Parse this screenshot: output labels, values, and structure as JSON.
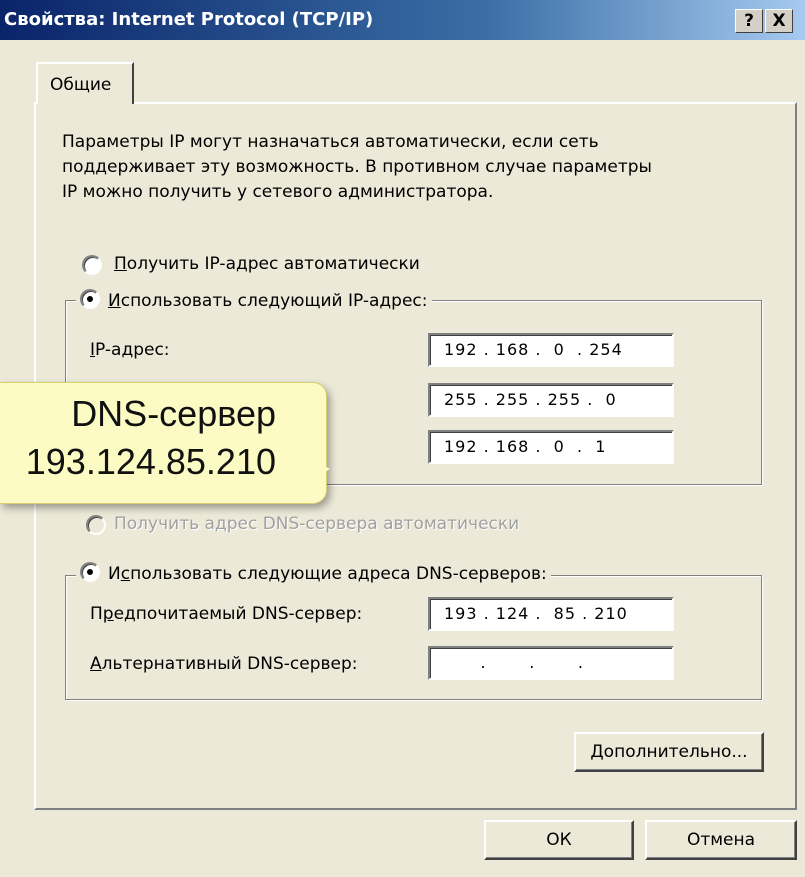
{
  "window": {
    "title": "Свойства: Internet Protocol (TCP/IP)",
    "help_glyph": "?",
    "close_glyph": "X"
  },
  "tabs": [
    {
      "label": "Общие",
      "active": true
    }
  ],
  "intro_text": "Параметры IP могут назначаться автоматически, если сеть\nподдерживает эту возможность. В противном случае параметры\nIP можно получить у сетевого администратора.",
  "ip_section": {
    "auto_radio": {
      "label_u": "П",
      "label_rest": "олучить IP-адрес автоматически",
      "checked": false
    },
    "manual_radio": {
      "label_u": "И",
      "label_rest": "спользовать следующий IP-адрес:",
      "checked": true
    },
    "fields": [
      {
        "label_u": "I",
        "label_rest": "P-адрес:",
        "value": "192 . 168 .  0  . 254"
      },
      {
        "label_u": "",
        "label_rest": "",
        "value": "255 . 255 . 255 .  0"
      },
      {
        "label_u": "",
        "label_rest": "",
        "value": "192 . 168 .  0  .  1"
      }
    ]
  },
  "dns_section": {
    "auto_radio": {
      "label": "Получить адрес DNS-сервера автоматически",
      "checked": false,
      "disabled": true
    },
    "manual_radio": {
      "label_pre": "И",
      "label_u": "с",
      "label_rest": "пользовать следующие адреса DNS-серверов:",
      "checked": true
    },
    "preferred": {
      "label_pre": "П",
      "label_u": "р",
      "label_rest": "едпочитаемый DNS-сервер:",
      "value": "193 . 124 .  85 . 210"
    },
    "alternate": {
      "label_u": "А",
      "label_rest": "льтернативный DNS-сервер:",
      "value": "      .       .       ."
    }
  },
  "advanced_button": {
    "label_u": "Д",
    "label_rest": "ополнительно..."
  },
  "ok_button": "ОК",
  "cancel_button": "Отмена",
  "callout": {
    "line1": "DNS-сервер",
    "line2": "193.124.85.210"
  },
  "colors": {
    "titlebar_start": "#0a246a",
    "titlebar_end": "#a6caf0",
    "dialog_bg": "#ece9d8",
    "callout_bg": "#fdfbc4"
  }
}
